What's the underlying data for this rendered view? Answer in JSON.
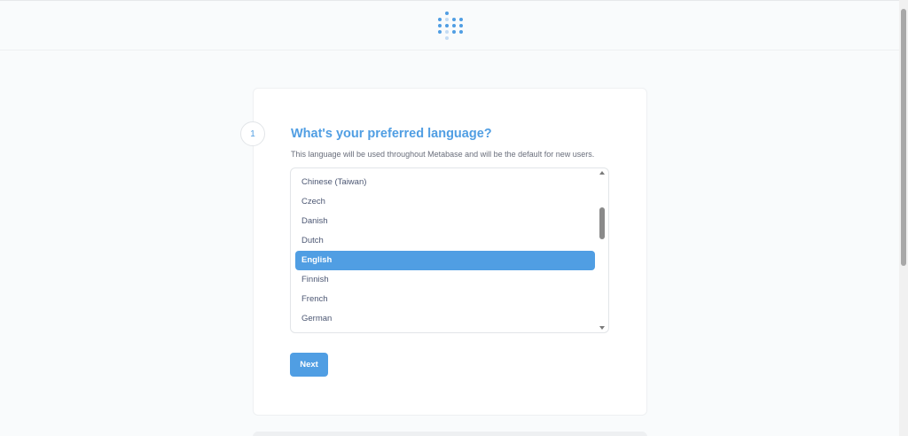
{
  "header": {
    "logo_icon": "metabase-logo-icon"
  },
  "step": {
    "number": "1",
    "title": "What's your preferred language?",
    "description": "This language will be used throughout Metabase and will be the default for new users."
  },
  "language_list": {
    "items": [
      {
        "label": "Chinese (Taiwan)",
        "selected": false
      },
      {
        "label": "Czech",
        "selected": false
      },
      {
        "label": "Danish",
        "selected": false
      },
      {
        "label": "Dutch",
        "selected": false
      },
      {
        "label": "English",
        "selected": true
      },
      {
        "label": "Finnish",
        "selected": false
      },
      {
        "label": "French",
        "selected": false
      },
      {
        "label": "German",
        "selected": false
      }
    ]
  },
  "actions": {
    "next_label": "Next"
  },
  "colors": {
    "brand": "#509ee3",
    "background": "#f9fbfc",
    "text": "#4c5773"
  }
}
